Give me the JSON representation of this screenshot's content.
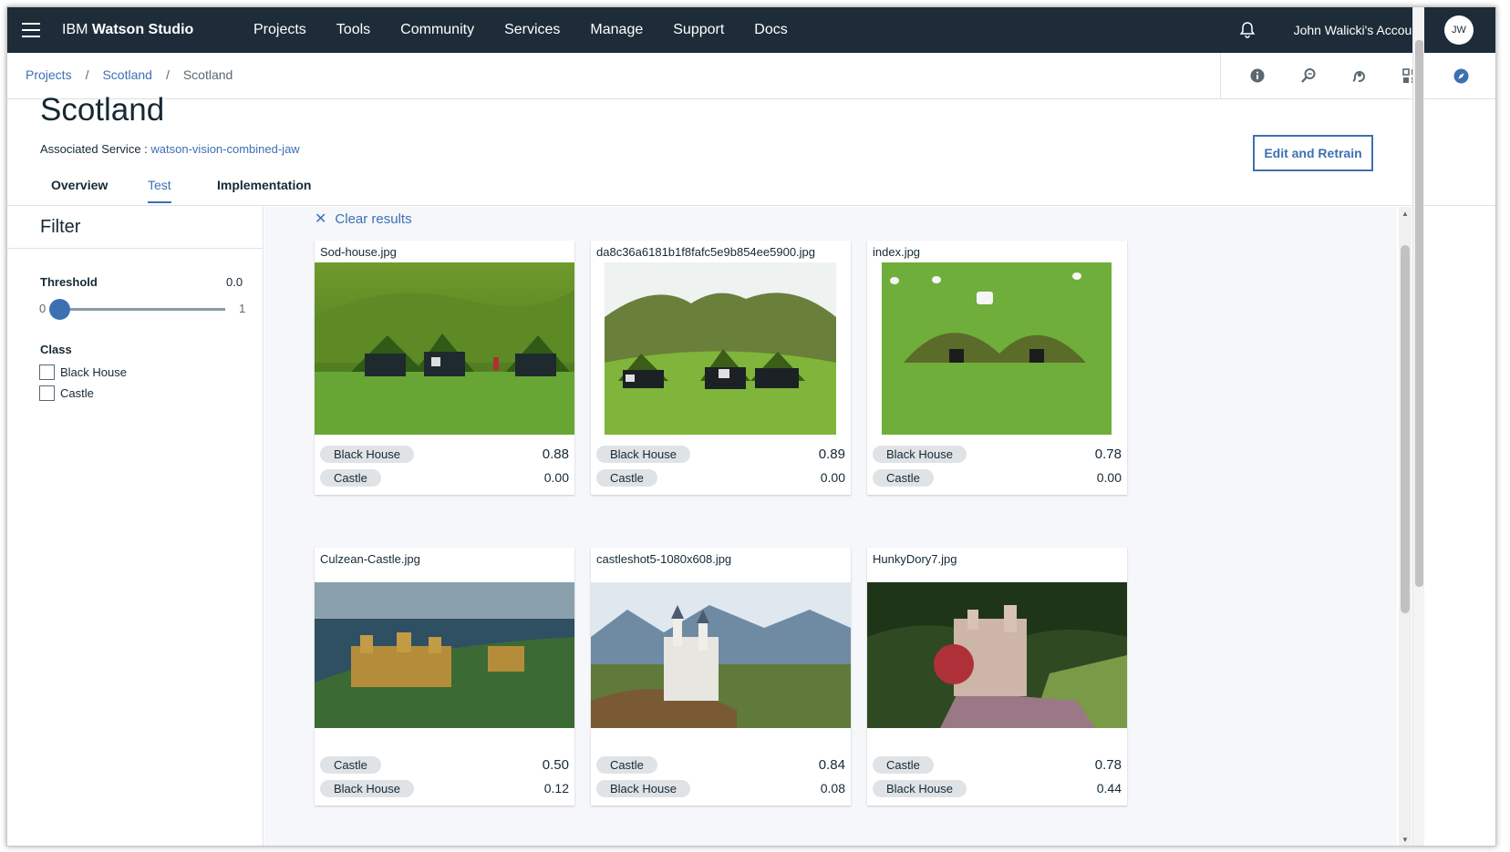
{
  "nav": {
    "brand_prefix": "IBM",
    "brand_name": "Watson Studio",
    "links": [
      "Projects",
      "Tools",
      "Community",
      "Services",
      "Manage",
      "Support",
      "Docs"
    ],
    "account": "John Walicki's Account",
    "avatar_initials": "JW"
  },
  "breadcrumb": {
    "items": [
      "Projects",
      "Scotland",
      "Scotland"
    ],
    "separator": "/"
  },
  "toolbar_icons": [
    "info-icon",
    "find-data-icon",
    "community-icon",
    "apps-icon",
    "compass-icon"
  ],
  "header": {
    "title": "Scotland",
    "service_label": "Associated Service :",
    "service_link": "watson-vision-combined-jaw",
    "edit_button": "Edit and Retrain"
  },
  "tabs": [
    {
      "label": "Overview",
      "active": false
    },
    {
      "label": "Test",
      "active": true
    },
    {
      "label": "Implementation",
      "active": false
    }
  ],
  "filter": {
    "title": "Filter",
    "threshold_label": "Threshold",
    "threshold_value": "0.0",
    "slider_min": "0",
    "slider_max": "1",
    "class_label": "Class",
    "classes": [
      "Black House",
      "Castle"
    ]
  },
  "results": {
    "clear_label": "Clear results",
    "cards": [
      {
        "filename": "Sod-house.jpg",
        "image": "sod-houses",
        "scores": [
          {
            "cls": "Black House",
            "value": "0.88"
          },
          {
            "cls": "Castle",
            "value": "0.00"
          }
        ]
      },
      {
        "filename": "da8c36a6181b1f8fafc5e9b854ee5900.jpg",
        "image": "turf-houses-mountain",
        "scores": [
          {
            "cls": "Black House",
            "value": "0.89"
          },
          {
            "cls": "Castle",
            "value": "0.00"
          }
        ]
      },
      {
        "filename": "index.jpg",
        "image": "turf-house-field",
        "scores": [
          {
            "cls": "Black House",
            "value": "0.78"
          },
          {
            "cls": "Castle",
            "value": "0.00"
          }
        ]
      },
      {
        "filename": "Culzean-Castle.jpg",
        "image": "coastal-castle",
        "scores": [
          {
            "cls": "Castle",
            "value": "0.50"
          },
          {
            "cls": "Black House",
            "value": "0.12"
          }
        ]
      },
      {
        "filename": "castleshot5-1080x608.jpg",
        "image": "mountain-castle",
        "scores": [
          {
            "cls": "Castle",
            "value": "0.84"
          },
          {
            "cls": "Black House",
            "value": "0.08"
          }
        ]
      },
      {
        "filename": "HunkyDory7.jpg",
        "image": "red-ivy-castle",
        "scores": [
          {
            "cls": "Castle",
            "value": "0.78"
          },
          {
            "cls": "Black House",
            "value": "0.44"
          }
        ]
      }
    ]
  },
  "colors": {
    "nav_bg": "#1d2c38",
    "accent": "#3d70b2",
    "pill_bg": "#dfe3e6",
    "main_bg": "#f5f7fa"
  }
}
